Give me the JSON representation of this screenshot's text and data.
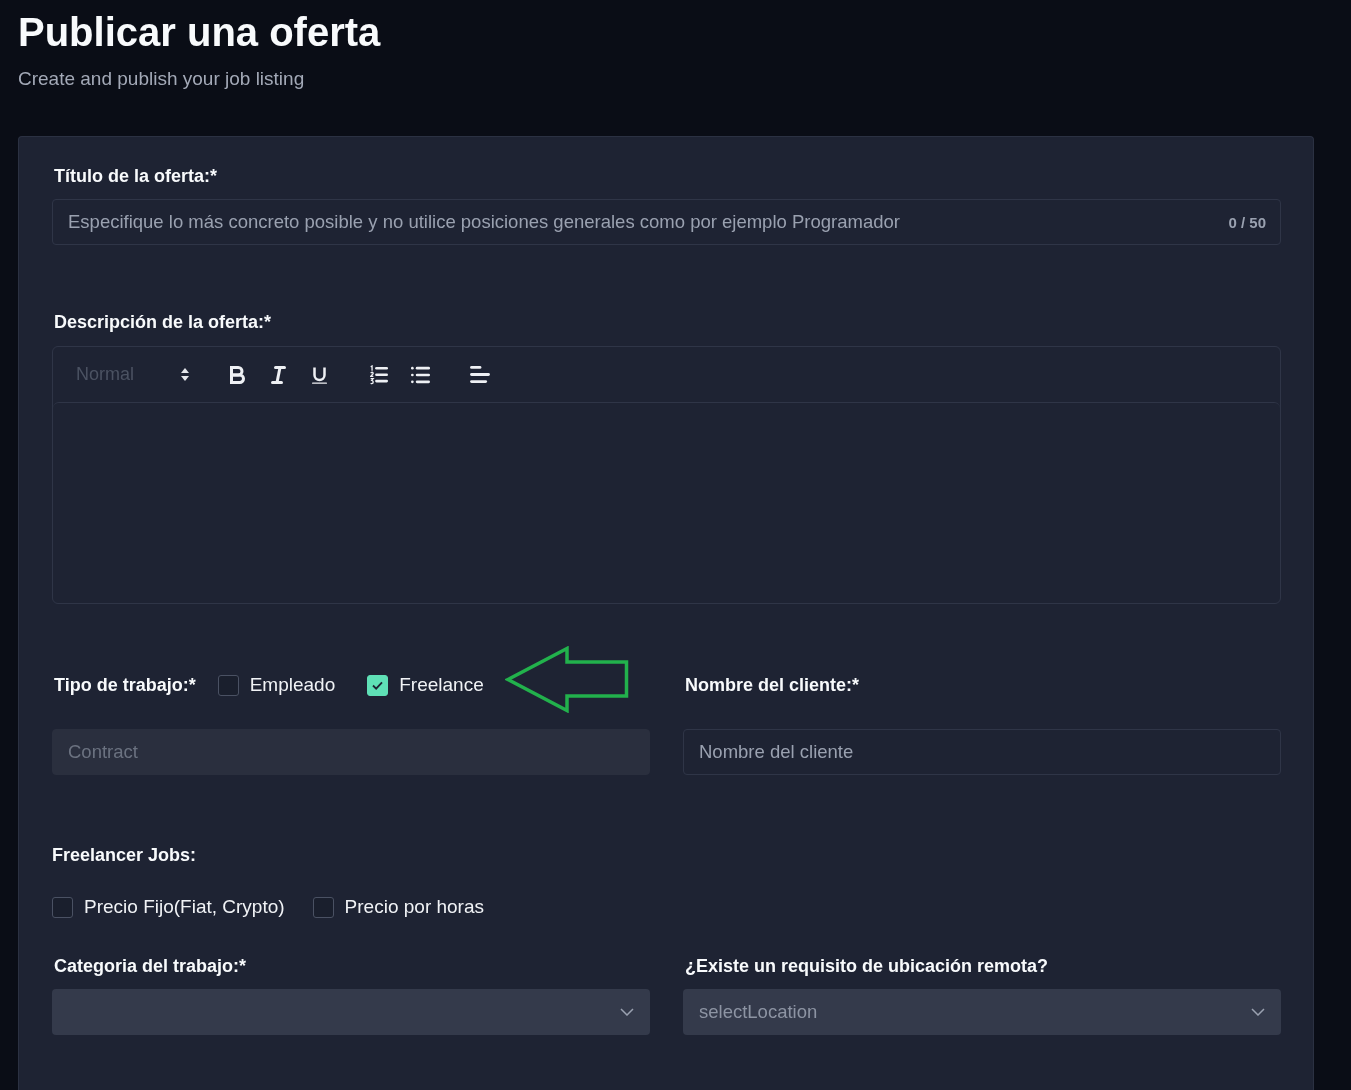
{
  "header": {
    "title": "Publicar una oferta",
    "subtitle": "Create and publish your job listing"
  },
  "form": {
    "job_title": {
      "label": "Título de la oferta:*",
      "placeholder": "Especifique lo más concreto posible y no utilice posiciones generales como por ejemplo Programador",
      "counter": "0 / 50"
    },
    "description": {
      "label": "Descripción de la oferta:*",
      "format": "Normal",
      "tool_groups": [
        {
          "tools": [
            {
              "kind": "bold"
            },
            {
              "kind": "italic"
            },
            {
              "kind": "underline"
            }
          ]
        },
        {
          "tools": [
            {
              "kind": "ordered-list"
            },
            {
              "kind": "bullet-list"
            }
          ]
        },
        {
          "tools": [
            {
              "kind": "align-left"
            }
          ]
        }
      ]
    },
    "job_type": {
      "label": "Tipo de trabajo:*",
      "options": [
        {
          "label": "Empleado",
          "checked": false
        },
        {
          "label": "Freelance",
          "checked": true
        }
      ],
      "field": {
        "value": "Contract",
        "disabled": true
      }
    },
    "client_name": {
      "label": "Nombre del cliente:*",
      "placeholder": "Nombre del cliente"
    },
    "freelancer_jobs": {
      "label": "Freelancer Jobs:",
      "options": [
        {
          "label": "Precio Fijo(Fiat, Crypto)",
          "checked": false
        },
        {
          "label": "Precio por horas",
          "checked": false
        }
      ]
    },
    "category": {
      "label": "Categoria del trabajo:*"
    },
    "remote_location": {
      "label": "¿Existe un requisito de ubicación remota?",
      "placeholder": "selectLocation"
    }
  }
}
